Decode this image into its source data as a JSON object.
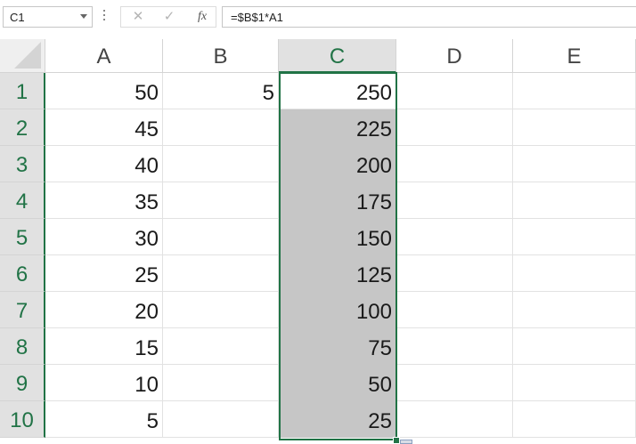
{
  "formula_bar": {
    "name_box": "C1",
    "cancel_icon": "x-icon",
    "enter_icon": "check-icon",
    "fx_label": "fx",
    "formula": "=$B$1*A1"
  },
  "columns": [
    "A",
    "B",
    "C",
    "D",
    "E"
  ],
  "rows": [
    "1",
    "2",
    "3",
    "4",
    "5",
    "6",
    "7",
    "8",
    "9",
    "10"
  ],
  "cells": {
    "A": [
      "50",
      "45",
      "40",
      "35",
      "30",
      "25",
      "20",
      "15",
      "10",
      "5"
    ],
    "B": [
      "5",
      "",
      "",
      "",
      "",
      "",
      "",
      "",
      "",
      ""
    ],
    "C": [
      "250",
      "225",
      "200",
      "175",
      "150",
      "125",
      "100",
      "75",
      "50",
      "25"
    ]
  },
  "selection": {
    "active_cell": "C1",
    "range": "C1:C10",
    "accent_color": "#217346"
  }
}
